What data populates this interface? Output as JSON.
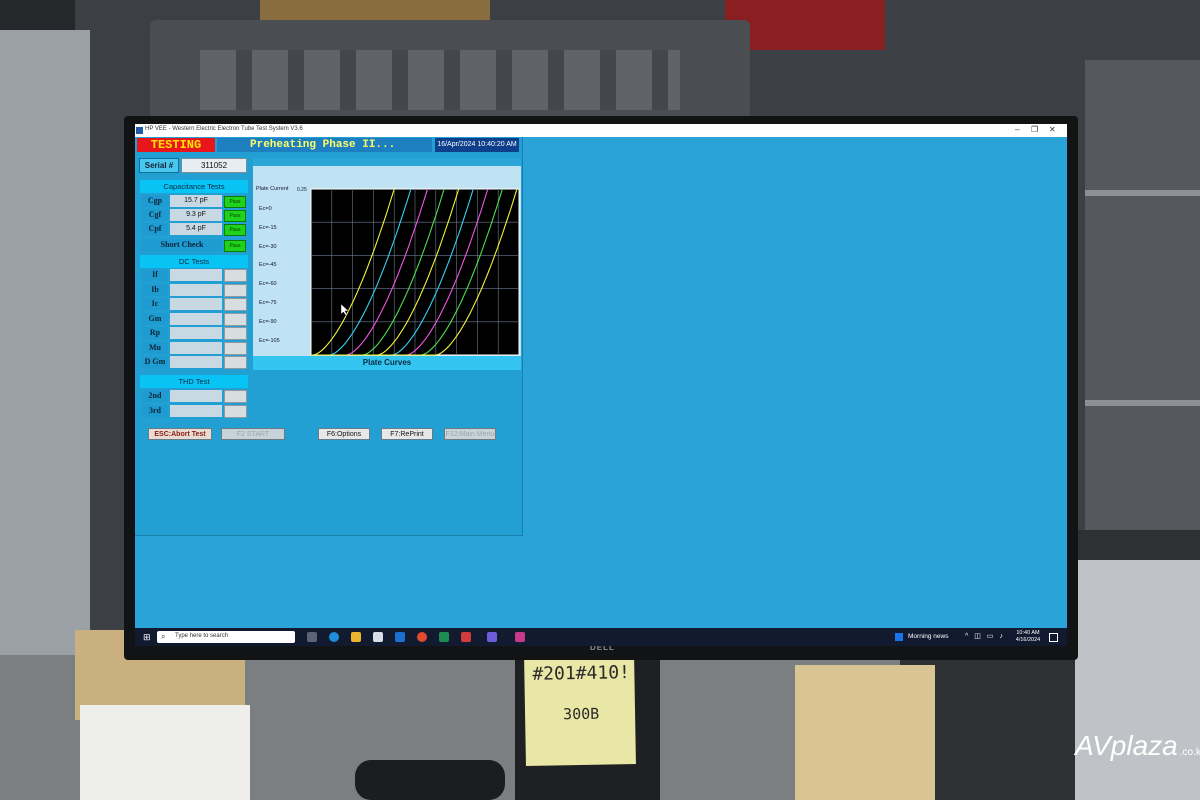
{
  "window": {
    "title": "HP VEE - Western Electric Electron Tube Test System V3.6",
    "minimize": "–",
    "maximize": "❐",
    "close": "✕"
  },
  "status": {
    "state": "TESTING",
    "phase": "Preheating Phase II...",
    "clock": "16/Apr/2024 10:40:20 AM"
  },
  "serial": {
    "label": "Serial #",
    "value": "311052"
  },
  "capacitance": {
    "title": "Capacitance Tests",
    "rows": [
      {
        "label": "Cgp",
        "value": "15.7 pF",
        "status": "Pass"
      },
      {
        "label": "Cgf",
        "value": "9.3 pF",
        "status": "Pass"
      },
      {
        "label": "Cpf",
        "value": "5.4 pF",
        "status": "Pass"
      }
    ],
    "short_check": {
      "label": "Short Check",
      "status": "Pass"
    }
  },
  "dc": {
    "title": "DC Tests",
    "rows": [
      "If",
      "Ib",
      "Ic",
      "Gm",
      "Rp",
      "Mu",
      "D Gm"
    ]
  },
  "thd": {
    "title": "THD Test",
    "rows": [
      "2nd",
      "3rd"
    ]
  },
  "chart_data": {
    "type": "line",
    "title": "Plate Curves",
    "ylabel": "Plate Current",
    "y_tick_top": "0.25",
    "x_tick_start": "0",
    "x_tick_end": "50",
    "grid": true,
    "legend": [
      "Ec=0",
      "Ec=-15",
      "Ec=-30",
      "Ec=-45",
      "Ec=-60",
      "Ec=-75",
      "Ec=-90",
      "Ec=-105"
    ],
    "x_range": [
      0,
      500
    ],
    "y_range": [
      0,
      0.25
    ],
    "series": [
      {
        "color": "#f4f43a",
        "onset": 5
      },
      {
        "color": "#35d3f4",
        "onset": 45
      },
      {
        "color": "#f455e8",
        "onset": 85
      },
      {
        "color": "#4de04d",
        "onset": 125
      },
      {
        "color": "#f4f43a",
        "onset": 160
      },
      {
        "color": "#35d3f4",
        "onset": 195
      },
      {
        "color": "#f455e8",
        "onset": 230
      },
      {
        "color": "#4de04d",
        "onset": 265
      },
      {
        "color": "#f4f43a",
        "onset": 300
      }
    ]
  },
  "function_keys": [
    {
      "label": "ESC:Abort Test",
      "state": "esc"
    },
    {
      "label": "F2 START",
      "state": "off"
    },
    {
      "label": "F6:Options",
      "state": "on"
    },
    {
      "label": "F7:RePrint",
      "state": "on"
    },
    {
      "label": "F12:Main Menu",
      "state": "off"
    }
  ],
  "taskbar": {
    "search_placeholder": "Type here to search",
    "news": "Morning news",
    "time": "10:40 AM",
    "date": "4/16/2024",
    "start_icon": "windows-logo-icon"
  },
  "environment": {
    "monitor_brand": "DELL",
    "sticky_note_line1": "#201#410!",
    "sticky_note_line2": "300B",
    "watermark": "AVplaza",
    "watermark_domain": ".co.kr"
  }
}
